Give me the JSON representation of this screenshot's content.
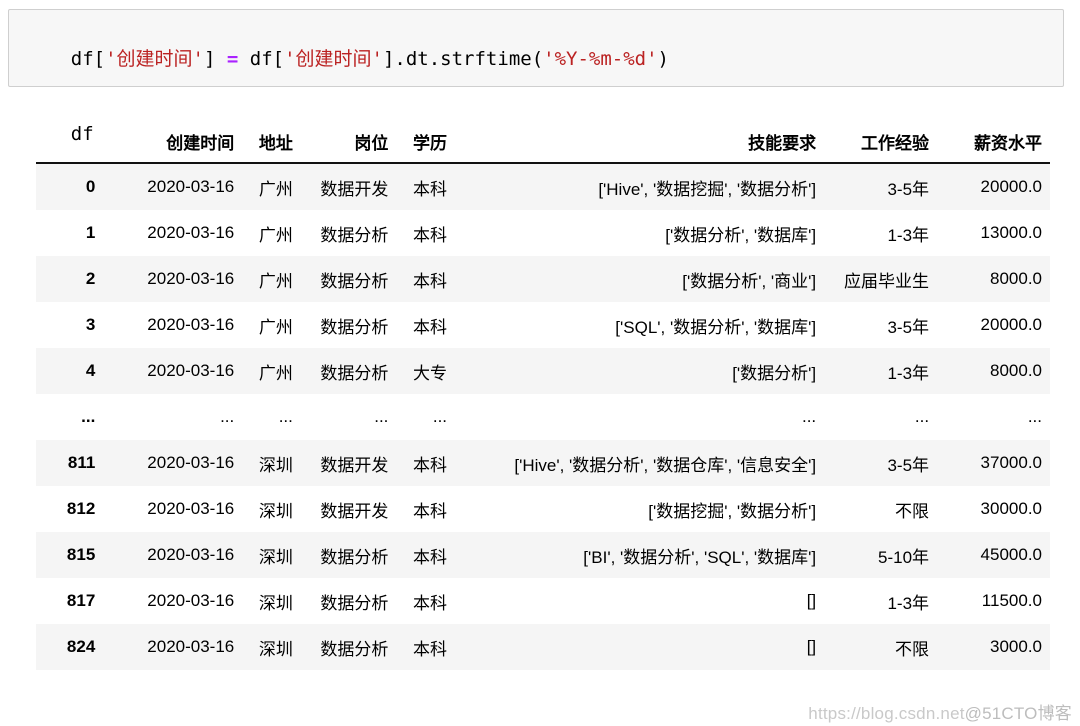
{
  "code_cell": {
    "lines": [
      {
        "segments": [
          {
            "text": "df[",
            "type": "plain"
          },
          {
            "text": "'创建时间'",
            "type": "string"
          },
          {
            "text": "] ",
            "type": "plain"
          },
          {
            "text": "=",
            "type": "operator"
          },
          {
            "text": " df[",
            "type": "plain"
          },
          {
            "text": "'创建时间'",
            "type": "string"
          },
          {
            "text": "].dt.strftime(",
            "type": "plain"
          },
          {
            "text": "'%Y-%m-%d'",
            "type": "string"
          },
          {
            "text": ")",
            "type": "plain"
          }
        ],
        "plain_text": "df['创建时间'] = df['创建时间'].dt.strftime('%Y-%m-%d')"
      },
      {
        "segments": [
          {
            "text": "df",
            "type": "plain"
          }
        ],
        "plain_text": "df"
      }
    ]
  },
  "dataframe": {
    "index_header": "",
    "columns": [
      "创建时间",
      "地址",
      "岗位",
      "学历",
      "技能要求",
      "工作经验",
      "薪资水平"
    ],
    "rows": [
      {
        "index": "0",
        "创建时间": "2020-03-16",
        "地址": "广州",
        "岗位": "数据开发",
        "学历": "本科",
        "技能要求": "['Hive', '数据挖掘', '数据分析']",
        "工作经验": "3-5年",
        "薪资水平": "20000.0"
      },
      {
        "index": "1",
        "创建时间": "2020-03-16",
        "地址": "广州",
        "岗位": "数据分析",
        "学历": "本科",
        "技能要求": "['数据分析', '数据库']",
        "工作经验": "1-3年",
        "薪资水平": "13000.0"
      },
      {
        "index": "2",
        "创建时间": "2020-03-16",
        "地址": "广州",
        "岗位": "数据分析",
        "学历": "本科",
        "技能要求": "['数据分析', '商业']",
        "工作经验": "应届毕业生",
        "薪资水平": "8000.0"
      },
      {
        "index": "3",
        "创建时间": "2020-03-16",
        "地址": "广州",
        "岗位": "数据分析",
        "学历": "本科",
        "技能要求": "['SQL', '数据分析', '数据库']",
        "工作经验": "3-5年",
        "薪资水平": "20000.0"
      },
      {
        "index": "4",
        "创建时间": "2020-03-16",
        "地址": "广州",
        "岗位": "数据分析",
        "学历": "大专",
        "技能要求": "['数据分析']",
        "工作经验": "1-3年",
        "薪资水平": "8000.0"
      },
      {
        "index": "...",
        "创建时间": "...",
        "地址": "...",
        "岗位": "...",
        "学历": "...",
        "技能要求": "...",
        "工作经验": "...",
        "薪资水平": "..."
      },
      {
        "index": "811",
        "创建时间": "2020-03-16",
        "地址": "深圳",
        "岗位": "数据开发",
        "学历": "本科",
        "技能要求": "['Hive', '数据分析', '数据仓库', '信息安全']",
        "工作经验": "3-5年",
        "薪资水平": "37000.0"
      },
      {
        "index": "812",
        "创建时间": "2020-03-16",
        "地址": "深圳",
        "岗位": "数据开发",
        "学历": "本科",
        "技能要求": "['数据挖掘', '数据分析']",
        "工作经验": "不限",
        "薪资水平": "30000.0"
      },
      {
        "index": "815",
        "创建时间": "2020-03-16",
        "地址": "深圳",
        "岗位": "数据分析",
        "学历": "本科",
        "技能要求": "['BI', '数据分析', 'SQL', '数据库']",
        "工作经验": "5-10年",
        "薪资水平": "45000.0"
      },
      {
        "index": "817",
        "创建时间": "2020-03-16",
        "地址": "深圳",
        "岗位": "数据分析",
        "学历": "本科",
        "技能要求": "[]",
        "工作经验": "1-3年",
        "薪资水平": "11500.0"
      },
      {
        "index": "824",
        "创建时间": "2020-03-16",
        "地址": "深圳",
        "岗位": "数据分析",
        "学历": "本科",
        "技能要求": "[]",
        "工作经验": "不限",
        "薪资水平": "3000.0"
      }
    ]
  },
  "watermark": {
    "url": "https://blog.csdn.net",
    "tag": "@51CTO博客"
  },
  "colors": {
    "string_token": "#bb2222",
    "operator_token": "#aa22ff",
    "code_cell_bg": "#f7f7f7",
    "code_cell_border": "#cfcfcf",
    "row_stripe": "#f5f5f5",
    "header_rule": "#111111",
    "watermark": "#c9c9c9"
  }
}
